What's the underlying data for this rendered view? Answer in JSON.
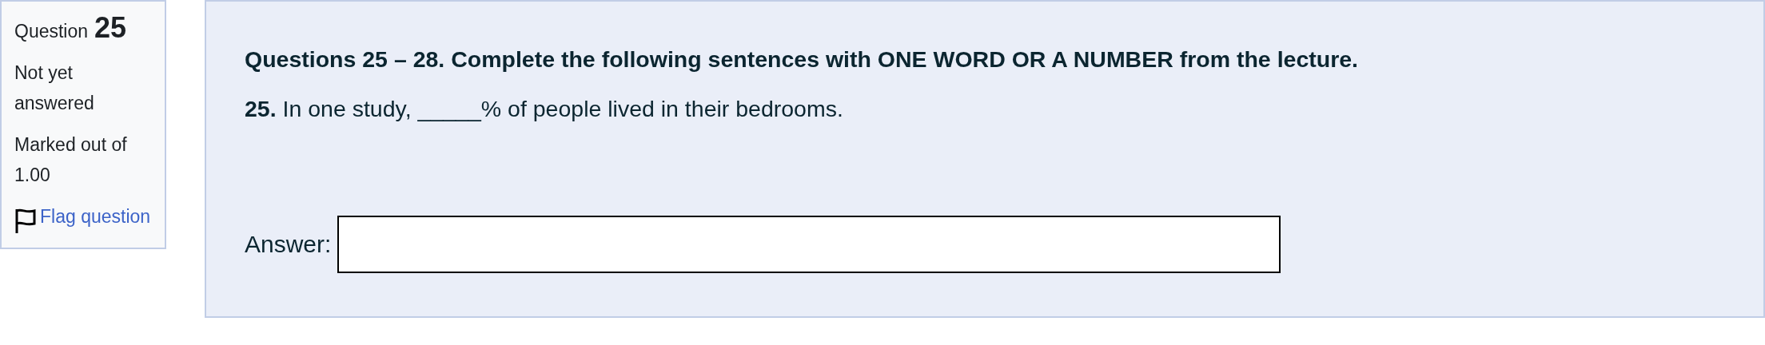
{
  "question_info": {
    "label": "Question",
    "number": "25",
    "status": "Not yet answered",
    "marks": "Marked out of 1.00",
    "flag_link": "Flag question",
    "flagged": false
  },
  "question": {
    "heading": "Questions 25 – 28. Complete the following sentences with ONE WORD OR A NUMBER from the lecture.",
    "sentence": "**25.** In one study, _____% of people lived in their bedrooms.",
    "answer_label": "Answer:"
  }
}
